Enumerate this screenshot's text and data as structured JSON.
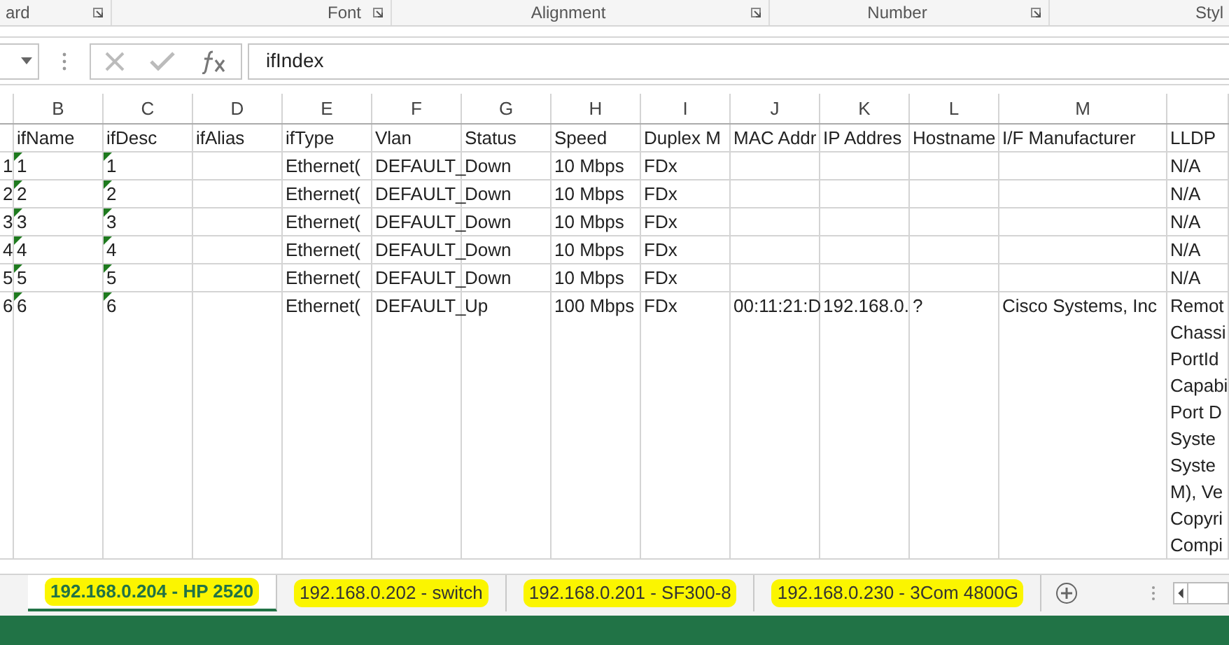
{
  "ribbon_groups": [
    {
      "label": "ard",
      "launcher": true
    },
    {
      "label": "Font",
      "launcher": true
    },
    {
      "label": "Alignment",
      "launcher": true
    },
    {
      "label": "Number",
      "launcher": true
    },
    {
      "label": "Styl",
      "launcher": false
    }
  ],
  "formula_bar": {
    "value": "ifIndex"
  },
  "columns": [
    {},
    {
      "letter": "B"
    },
    {
      "letter": "C"
    },
    {
      "letter": "D"
    },
    {
      "letter": "E"
    },
    {
      "letter": "F"
    },
    {
      "letter": "G"
    },
    {
      "letter": "H"
    },
    {
      "letter": "I"
    },
    {
      "letter": "J"
    },
    {
      "letter": "K"
    },
    {
      "letter": "L"
    },
    {
      "letter": "M"
    },
    {}
  ],
  "rows": [
    {
      "cells": [
        {
          "warning": false
        },
        {
          "text": "ifName",
          "warning": false
        },
        {
          "text": "ifDesc",
          "warning": false
        },
        {
          "text": "ifAlias",
          "warning": false
        },
        {
          "text": "ifType",
          "warning": false
        },
        {
          "text": "Vlan",
          "warning": false
        },
        {
          "text": "Status",
          "warning": false
        },
        {
          "text": "Speed",
          "warning": false
        },
        {
          "text": "Duplex M",
          "warning": false
        },
        {
          "text": "MAC Addr",
          "warning": false
        },
        {
          "text": "IP Addres",
          "warning": false
        },
        {
          "text": "Hostname",
          "warning": false
        },
        {
          "text": "I/F Manufacturer",
          "warning": false
        },
        {
          "text": "LLDP",
          "warning": false
        }
      ]
    },
    {
      "cells": [
        {
          "text": "1",
          "warning": false
        },
        {
          "text": "1",
          "warning": true
        },
        {
          "text": "1",
          "warning": true
        },
        {
          "warning": false
        },
        {
          "text": "Ethernet(",
          "warning": false
        },
        {
          "text": "DEFAULT_",
          "warning": false
        },
        {
          "text": "Down",
          "warning": false
        },
        {
          "text": "10 Mbps",
          "warning": false
        },
        {
          "text": "FDx",
          "warning": false
        },
        {
          "warning": false
        },
        {
          "warning": false
        },
        {
          "warning": false
        },
        {
          "warning": false
        },
        {
          "text": "N/A",
          "warning": false
        }
      ]
    },
    {
      "cells": [
        {
          "text": "2",
          "warning": false
        },
        {
          "text": "2",
          "warning": true
        },
        {
          "text": "2",
          "warning": true
        },
        {
          "warning": false
        },
        {
          "text": "Ethernet(",
          "warning": false
        },
        {
          "text": "DEFAULT_",
          "warning": false
        },
        {
          "text": "Down",
          "warning": false
        },
        {
          "text": "10 Mbps",
          "warning": false
        },
        {
          "text": "FDx",
          "warning": false
        },
        {
          "warning": false
        },
        {
          "warning": false
        },
        {
          "warning": false
        },
        {
          "warning": false
        },
        {
          "text": "N/A",
          "warning": false
        }
      ]
    },
    {
      "cells": [
        {
          "text": "3",
          "warning": false
        },
        {
          "text": "3",
          "warning": true
        },
        {
          "text": "3",
          "warning": true
        },
        {
          "warning": false
        },
        {
          "text": "Ethernet(",
          "warning": false
        },
        {
          "text": "DEFAULT_",
          "warning": false
        },
        {
          "text": "Down",
          "warning": false
        },
        {
          "text": "10 Mbps",
          "warning": false
        },
        {
          "text": "FDx",
          "warning": false
        },
        {
          "warning": false
        },
        {
          "warning": false
        },
        {
          "warning": false
        },
        {
          "warning": false
        },
        {
          "text": "N/A",
          "warning": false
        }
      ]
    },
    {
      "cells": [
        {
          "text": "4",
          "warning": false
        },
        {
          "text": "4",
          "warning": true
        },
        {
          "text": "4",
          "warning": true
        },
        {
          "warning": false
        },
        {
          "text": "Ethernet(",
          "warning": false
        },
        {
          "text": "DEFAULT_",
          "warning": false
        },
        {
          "text": "Down",
          "warning": false
        },
        {
          "text": "10 Mbps",
          "warning": false
        },
        {
          "text": "FDx",
          "warning": false
        },
        {
          "warning": false
        },
        {
          "warning": false
        },
        {
          "warning": false
        },
        {
          "warning": false
        },
        {
          "text": "N/A",
          "warning": false
        }
      ]
    },
    {
      "cells": [
        {
          "text": "5",
          "warning": false
        },
        {
          "text": "5",
          "warning": true
        },
        {
          "text": "5",
          "warning": true
        },
        {
          "warning": false
        },
        {
          "text": "Ethernet(",
          "warning": false
        },
        {
          "text": "DEFAULT_",
          "warning": false
        },
        {
          "text": "Down",
          "warning": false
        },
        {
          "text": "10 Mbps",
          "warning": false
        },
        {
          "text": "FDx",
          "warning": false
        },
        {
          "warning": false
        },
        {
          "warning": false
        },
        {
          "warning": false
        },
        {
          "warning": false
        },
        {
          "text": "N/A",
          "warning": false
        }
      ]
    },
    {
      "cells": [
        {
          "text": "6",
          "warning": false
        },
        {
          "text": "6",
          "warning": true
        },
        {
          "text": "6",
          "warning": true
        },
        {
          "warning": false
        },
        {
          "text": "Ethernet(",
          "warning": false
        },
        {
          "text": "DEFAULT_",
          "warning": false
        },
        {
          "text": "Up",
          "warning": false
        },
        {
          "text": "100 Mbps",
          "warning": false
        },
        {
          "text": "FDx",
          "warning": false
        },
        {
          "text": "00:11:21:D",
          "warning": false
        },
        {
          "text": "192.168.0.",
          "warning": false
        },
        {
          "text": "?",
          "warning": false
        },
        {
          "text": "Cisco Systems, Inc",
          "warning": false
        },
        {
          "lines": [
            "Remot",
            "Chassi",
            "PortId",
            "Capabi",
            "Port D",
            "Syste",
            "Syste",
            "M), Ve",
            "Copyri",
            "Compi"
          ],
          "warning": false
        }
      ]
    }
  ],
  "sheet_tabs": [
    {
      "label": "192.168.0.204 - HP 2520",
      "selected": true,
      "highlighted": true
    },
    {
      "label": "192.168.0.202 - switch",
      "selected": false,
      "highlighted": true
    },
    {
      "label": "192.168.0.201 - SF300-8",
      "selected": false,
      "highlighted": true
    },
    {
      "label": "192.168.0.230 - 3Com 4800G",
      "selected": false,
      "highlighted": true
    }
  ]
}
